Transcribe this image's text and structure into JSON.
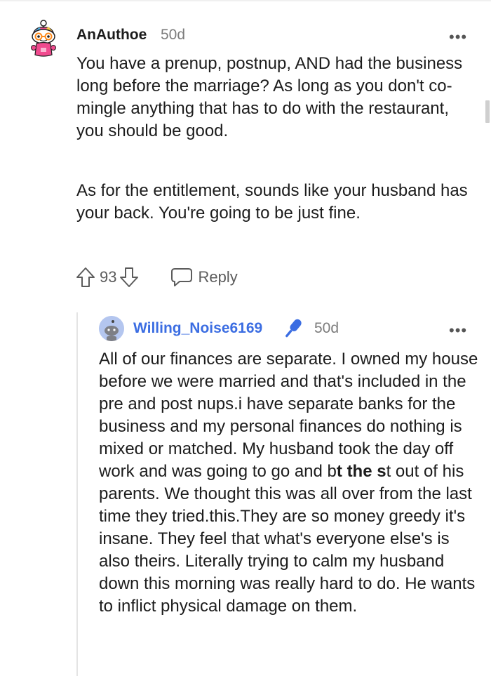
{
  "comment": {
    "author": "AnAuthoe",
    "age": "50d",
    "more_icon": "•••",
    "paragraph1": "You have a prenup, postnup, AND had the business long before the marriage? As long as you don't co-mingle anything that has to do with the restaurant, you should be good.",
    "paragraph2": "As for the entitlement, sounds like your husband has your back. You're going to be just fine.",
    "votes": "93",
    "reply_label": "Reply"
  },
  "reply": {
    "author": "Willing_Noise6169",
    "age": "50d",
    "more_icon": "•••",
    "text_part1": "All of our finances are separate. I owned my house before we were married and that's included in the pre and post nups.i have separate banks for the business and my personal finances do nothing is mixed or matched. My husband took the day off work and was going to go and b",
    "text_bold": "t the s",
    "text_part2": "t out of his parents. We thought this was all over from the last time they tried.this.They are so money greedy it's insane. They feel that what's everyone else's is also theirs. Literally trying to calm my husband down this morning was really hard to do. He wants to inflict physical damage on them."
  },
  "colors": {
    "reply_author": "#3b6de2",
    "mic_badge": "#3b6de2",
    "muted": "#7c7c7c"
  },
  "icons": [
    "snoo-avatar-icon",
    "upvote-icon",
    "downvote-icon",
    "reply-bubble-icon",
    "microphone-icon",
    "snoo-default-avatar-icon"
  ]
}
